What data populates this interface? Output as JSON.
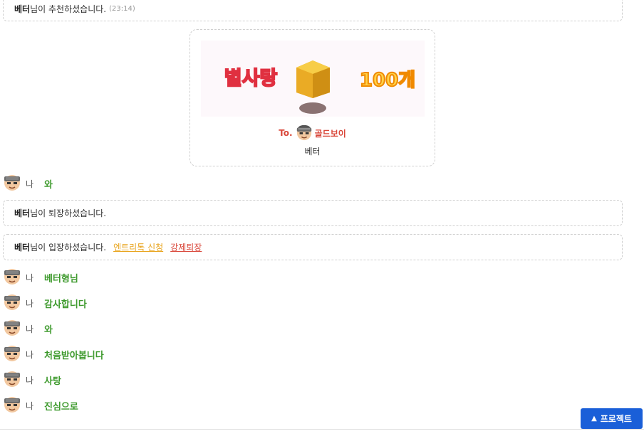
{
  "system_messages": [
    {
      "user": "베터",
      "text": "님이 추천하셨습니다.",
      "time": "(23:14)"
    },
    {
      "user": "베터",
      "text": "님이 퇴장하셨습니다."
    },
    {
      "user": "베터",
      "text": "님이 입장하셨습니다.",
      "link_entry": "엔트리톡 신청",
      "link_kick": "강제퇴장"
    }
  ],
  "gift": {
    "banner_item": "별사탕",
    "banner_count": "100개",
    "to_label": "To.",
    "recipient": "골드보이",
    "sender": "베터"
  },
  "chat": [
    {
      "who": "나",
      "text": "와"
    },
    {
      "who": "나",
      "text": "베터형님"
    },
    {
      "who": "나",
      "text": "감사합니다"
    },
    {
      "who": "나",
      "text": "와"
    },
    {
      "who": "나",
      "text": "처음받아봅니다"
    },
    {
      "who": "나",
      "text": "사탕"
    },
    {
      "who": "나",
      "text": "진심으로"
    }
  ],
  "project_button": {
    "label": "프로젝트"
  },
  "colors": {
    "chat_text": "#3e9a2d",
    "recipient": "#d9473a",
    "link_entry": "#e8a31b",
    "link_kick": "#d9473a",
    "project_button": "#1a5fd8"
  }
}
